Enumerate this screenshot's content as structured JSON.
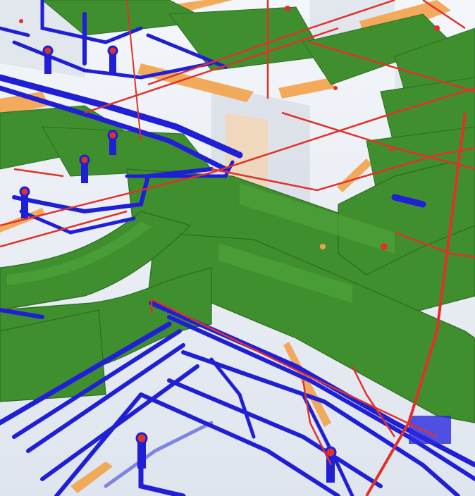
{
  "scene": {
    "type": "bim-mep-3d-model-view",
    "systems": [
      {
        "name": "supply-air-duct",
        "color": "#3f8f2f"
      },
      {
        "name": "water-pipe",
        "color": "#1f1fd6"
      },
      {
        "name": "fire-sprinkler-pipe",
        "color": "#e0322a"
      },
      {
        "name": "cable-tray",
        "color": "#f3a24a"
      }
    ],
    "background": "#e9edf3"
  }
}
